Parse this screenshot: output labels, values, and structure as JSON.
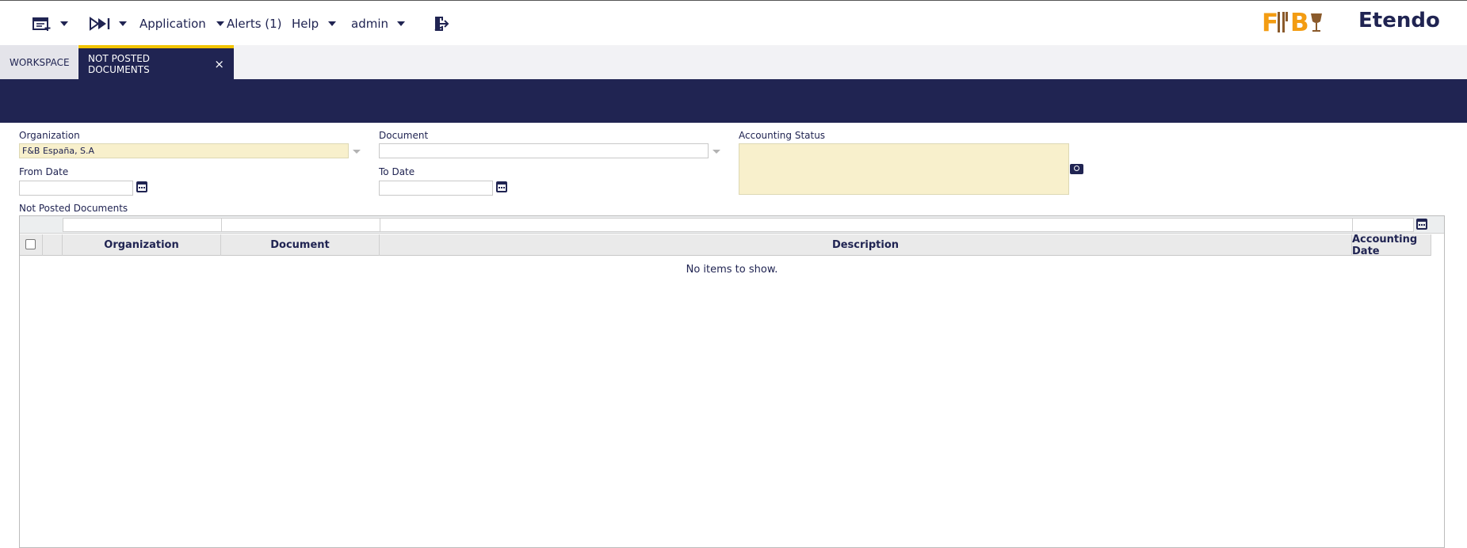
{
  "topbar": {
    "application_label": "Application",
    "alerts_label": "Alerts (1)",
    "help_label": "Help",
    "user_label": "admin",
    "logo_brand": "F&B",
    "logo_name": "Etendo"
  },
  "tabs": [
    {
      "label": "WORKSPACE"
    },
    {
      "label": "NOT POSTED DOCUMENTS",
      "close": "×"
    }
  ],
  "form": {
    "organization_label": "Organization",
    "organization_value": "F&B España, S.A",
    "document_label": "Document",
    "document_value": "",
    "accounting_status_label": "Accounting Status",
    "from_date_label": "From Date",
    "to_date_label": "To Date"
  },
  "grid": {
    "title": "Not Posted Documents",
    "columns": [
      "Organization",
      "Document",
      "Description",
      "Accounting Date"
    ],
    "empty_message": "No items to show."
  },
  "colors": {
    "brand_navy": "#202452",
    "brand_orange": "#f39c12",
    "tab_accent": "#f2c400",
    "required_field": "#f8f0cc"
  }
}
